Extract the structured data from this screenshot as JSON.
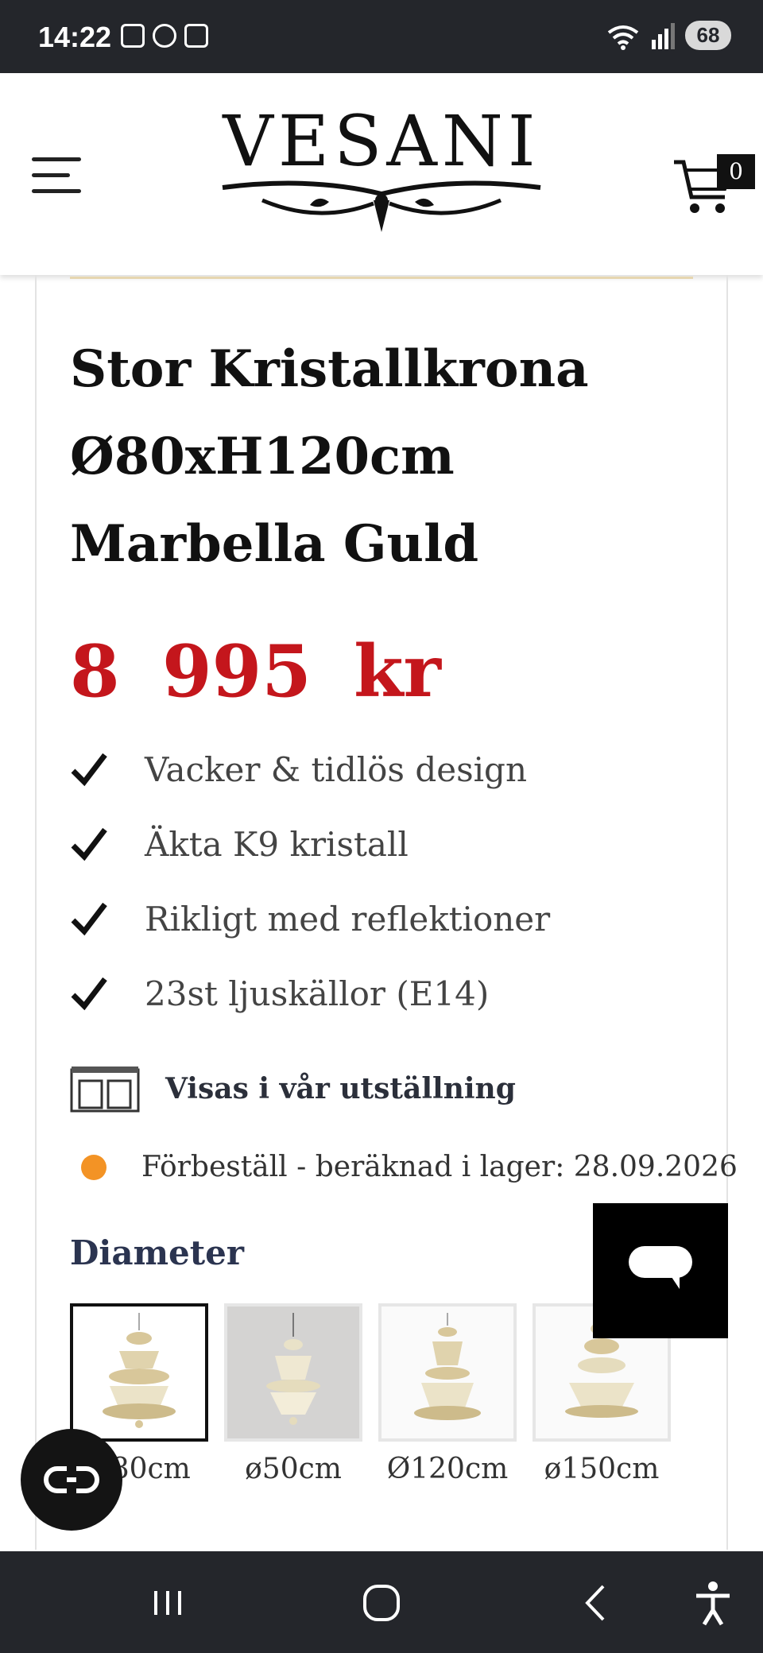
{
  "status_bar": {
    "time": "14:22",
    "battery": "68",
    "icons": [
      "screenshot-icon",
      "fan-icon",
      "calendar-icon",
      "wifi-icon",
      "signal-icon"
    ]
  },
  "header": {
    "logo_text": "VESANI",
    "cart_count": "0",
    "icons": [
      "menu-icon",
      "cart-icon"
    ]
  },
  "product": {
    "title": "Stor Kristallkrona Ø80xH120cm Marbella Guld",
    "price": "8 995 kr",
    "features": [
      "Vacker & tidlös design",
      "Äkta K9 kristall",
      "Rikligt med reflektioner",
      "23st ljuskällor (E14)"
    ],
    "showroom_label": "Visas i vår utställning",
    "stock_text": "Förbeställ - beräknad i lager: 28.09.2026",
    "option_label": "Diameter",
    "variants": [
      {
        "label": "Ø80cm",
        "selected": true
      },
      {
        "label": "ø50cm",
        "selected": false
      },
      {
        "label": "Ø120cm",
        "selected": false
      },
      {
        "label": "ø150cm",
        "selected": false
      }
    ]
  },
  "colors": {
    "price": "#c4161c",
    "stock_dot": "#f39325",
    "bars": "#24262b"
  },
  "nav": {
    "icons": [
      "recent-apps-icon",
      "home-icon",
      "back-icon",
      "accessibility-icon"
    ]
  }
}
